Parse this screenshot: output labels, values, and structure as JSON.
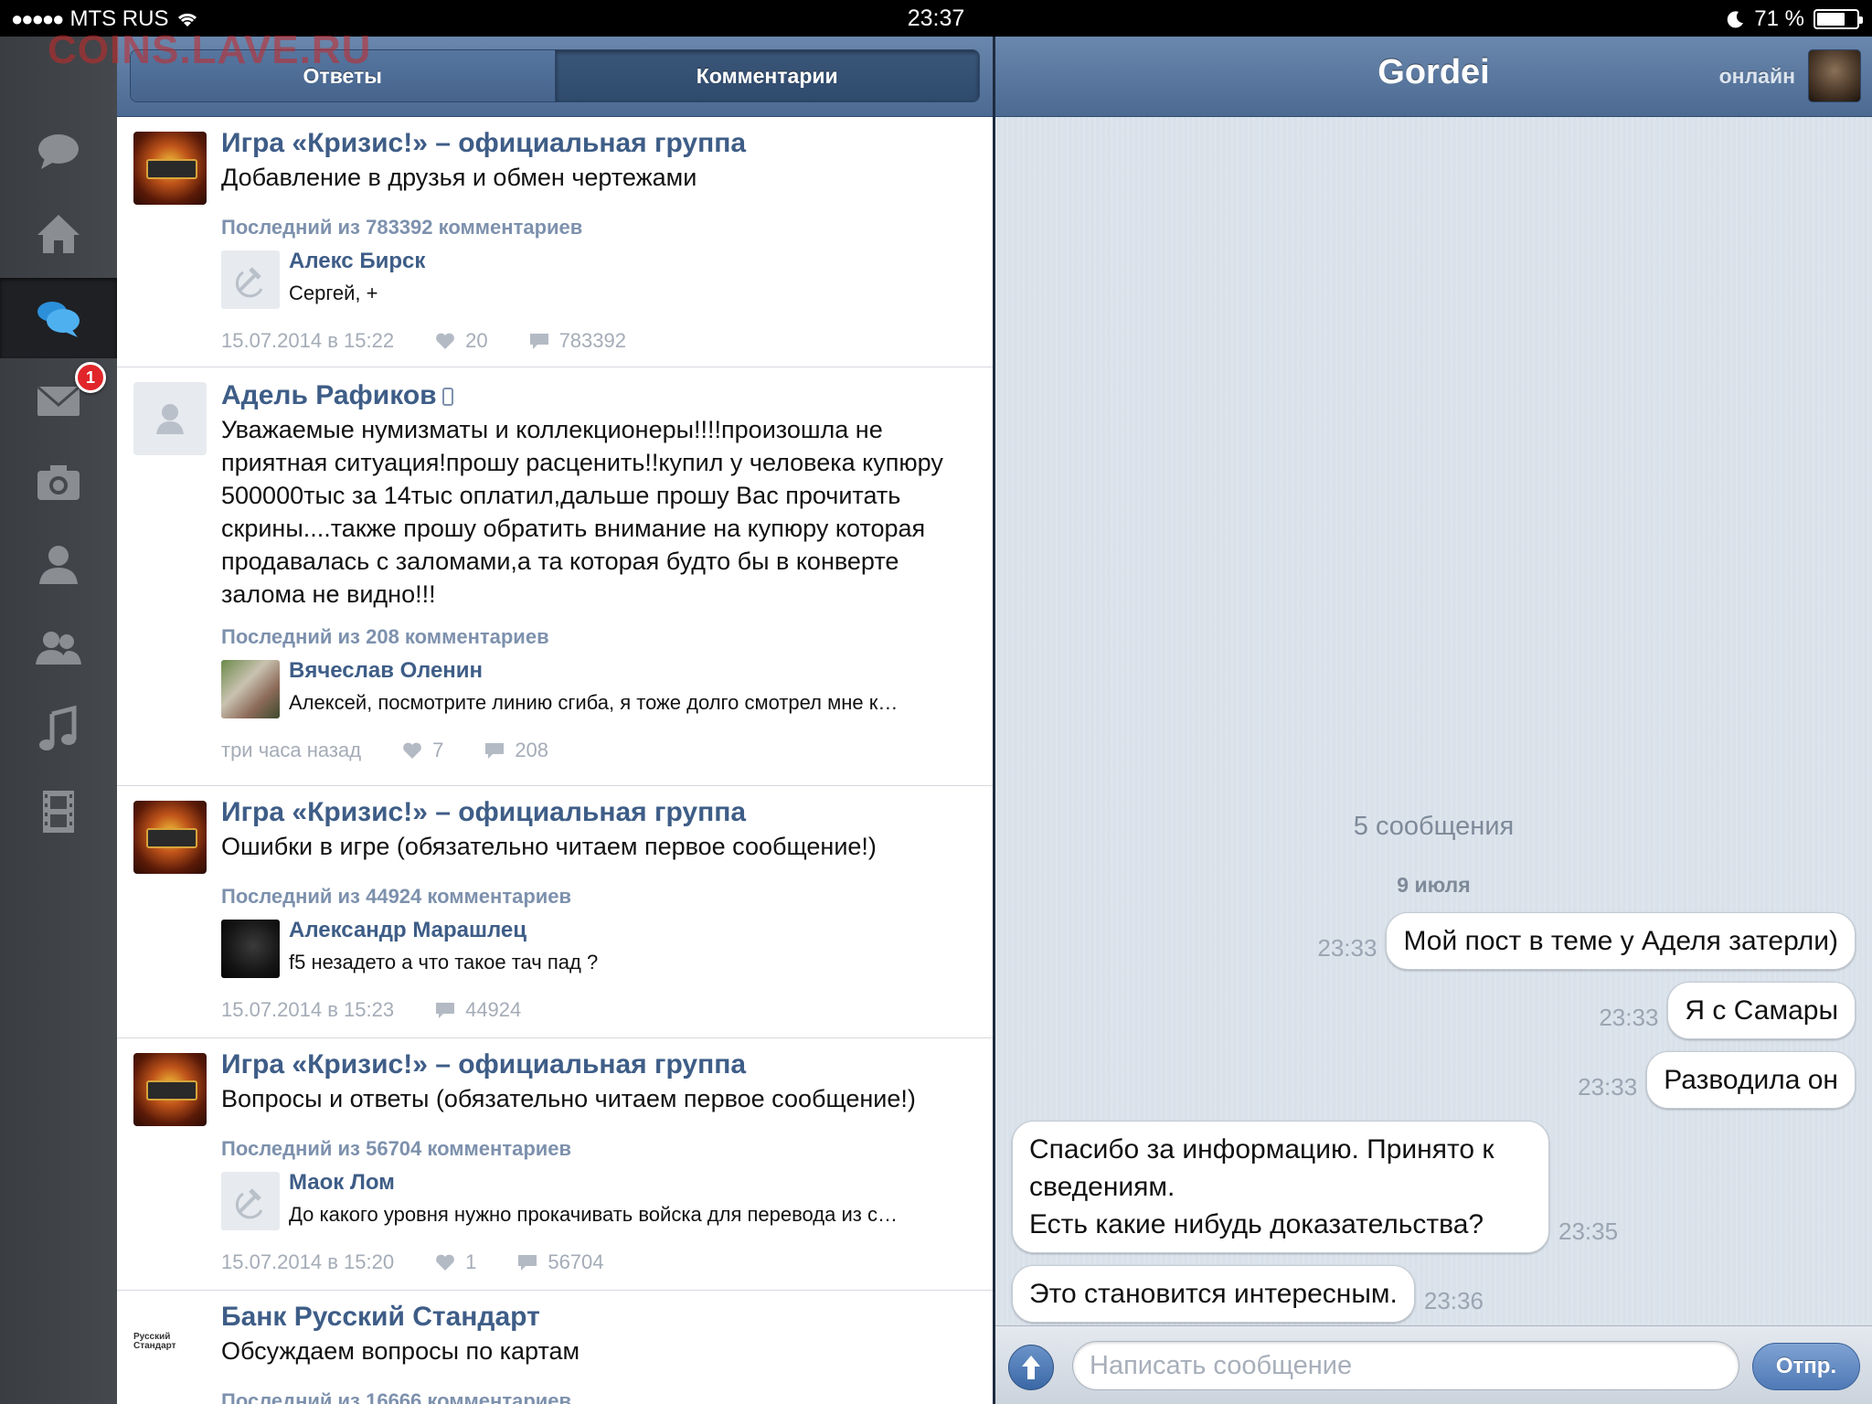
{
  "status_bar": {
    "carrier": "MTS RUS",
    "time": "23:37",
    "battery": "71 %",
    "battery_level": 0.71
  },
  "watermark": "COINS.LAVE.RU",
  "feed_tabs": [
    {
      "label": "Ответы",
      "active": false
    },
    {
      "label": "Комментарии",
      "active": true
    }
  ],
  "nav": {
    "items": [
      "chat-bubble-icon",
      "home-icon",
      "discussions-icon",
      "mail-icon",
      "camera-icon",
      "person-icon",
      "friends-icon",
      "music-icon",
      "video-icon"
    ],
    "active": "discussions-icon",
    "mail_badge": "1"
  },
  "posts": [
    {
      "title": "Игра «Кризис!» – официальная группа",
      "text": "Добавление в друзья и обмен чертежами",
      "last_label": "Последний из 783392 комментариев",
      "commenter": "Алекс Бирск",
      "comment": "Сергей, +",
      "date": "15.07.2014 в 15:22",
      "likes": "20",
      "comments": "783392"
    },
    {
      "title": "Адель Рафиков",
      "text": "Уважаемые нумизматы и коллекционеры!!!!произошла не приятная ситуация!прошу расценить!!купил у человека купюру 500000тыс за 14тыс оплатил,дальше прошу Вас прочитать скрины....также прошу обратить внимание на купюру которая продавалась с заломами,а та которая будто бы в конверте залома не видно!!!",
      "last_label": "Последний из 208 комментариев",
      "commenter": "Вячеслав Оленин",
      "comment": "Алексей, посмотрите линию сгиба, я тоже долго смотрел мне к…",
      "date": "три часа назад",
      "likes": "7",
      "comments": "208"
    },
    {
      "title": "Игра «Кризис!» – официальная группа",
      "text": "Ошибки в игре (обязательно читаем первое сообщение!)",
      "last_label": "Последний из 44924 комментариев",
      "commenter": "Александр Марашлец",
      "comment": "f5 незадето а что такое тач пад ?",
      "date": "15.07.2014 в 15:23",
      "comments": "44924"
    },
    {
      "title": "Игра «Кризис!» – официальная группа",
      "text": "Вопросы и ответы (обязательно читаем первое сообщение!)",
      "last_label": "Последний из 56704 комментариев",
      "commenter": "Маок Лом",
      "comment": "До какого уровня нужно прокачивать войска для перевода из с…",
      "date": "15.07.2014 в 15:20",
      "likes": "1",
      "comments": "56704"
    },
    {
      "title": "Банк Русский Стандарт",
      "text": "Обсуждаем вопросы по картам",
      "last_label": "Последний из 16666 комментариев",
      "logo_text": "Русский Стандарт"
    }
  ],
  "chat": {
    "name": "Gordei",
    "status": "онлайн",
    "count_label": "5 сообщения",
    "date_label": "9 июля",
    "messages": [
      {
        "text": "Мой пост в теме у Аделя затерли)",
        "time": "23:33",
        "outgoing": true
      },
      {
        "text": "Я с Самары",
        "time": "23:33",
        "outgoing": true
      },
      {
        "text": "Разводила он",
        "time": "23:33",
        "outgoing": true
      },
      {
        "text": "Спасибо за информацию. Принято к сведениям.\nЕсть какие нибудь доказательства?",
        "time": "23:35",
        "outgoing": false
      },
      {
        "text": "Это становится интересным.",
        "time": "23:36",
        "outgoing": false
      }
    ],
    "input_placeholder": "Написать сообщение",
    "send_label": "Отпр."
  }
}
